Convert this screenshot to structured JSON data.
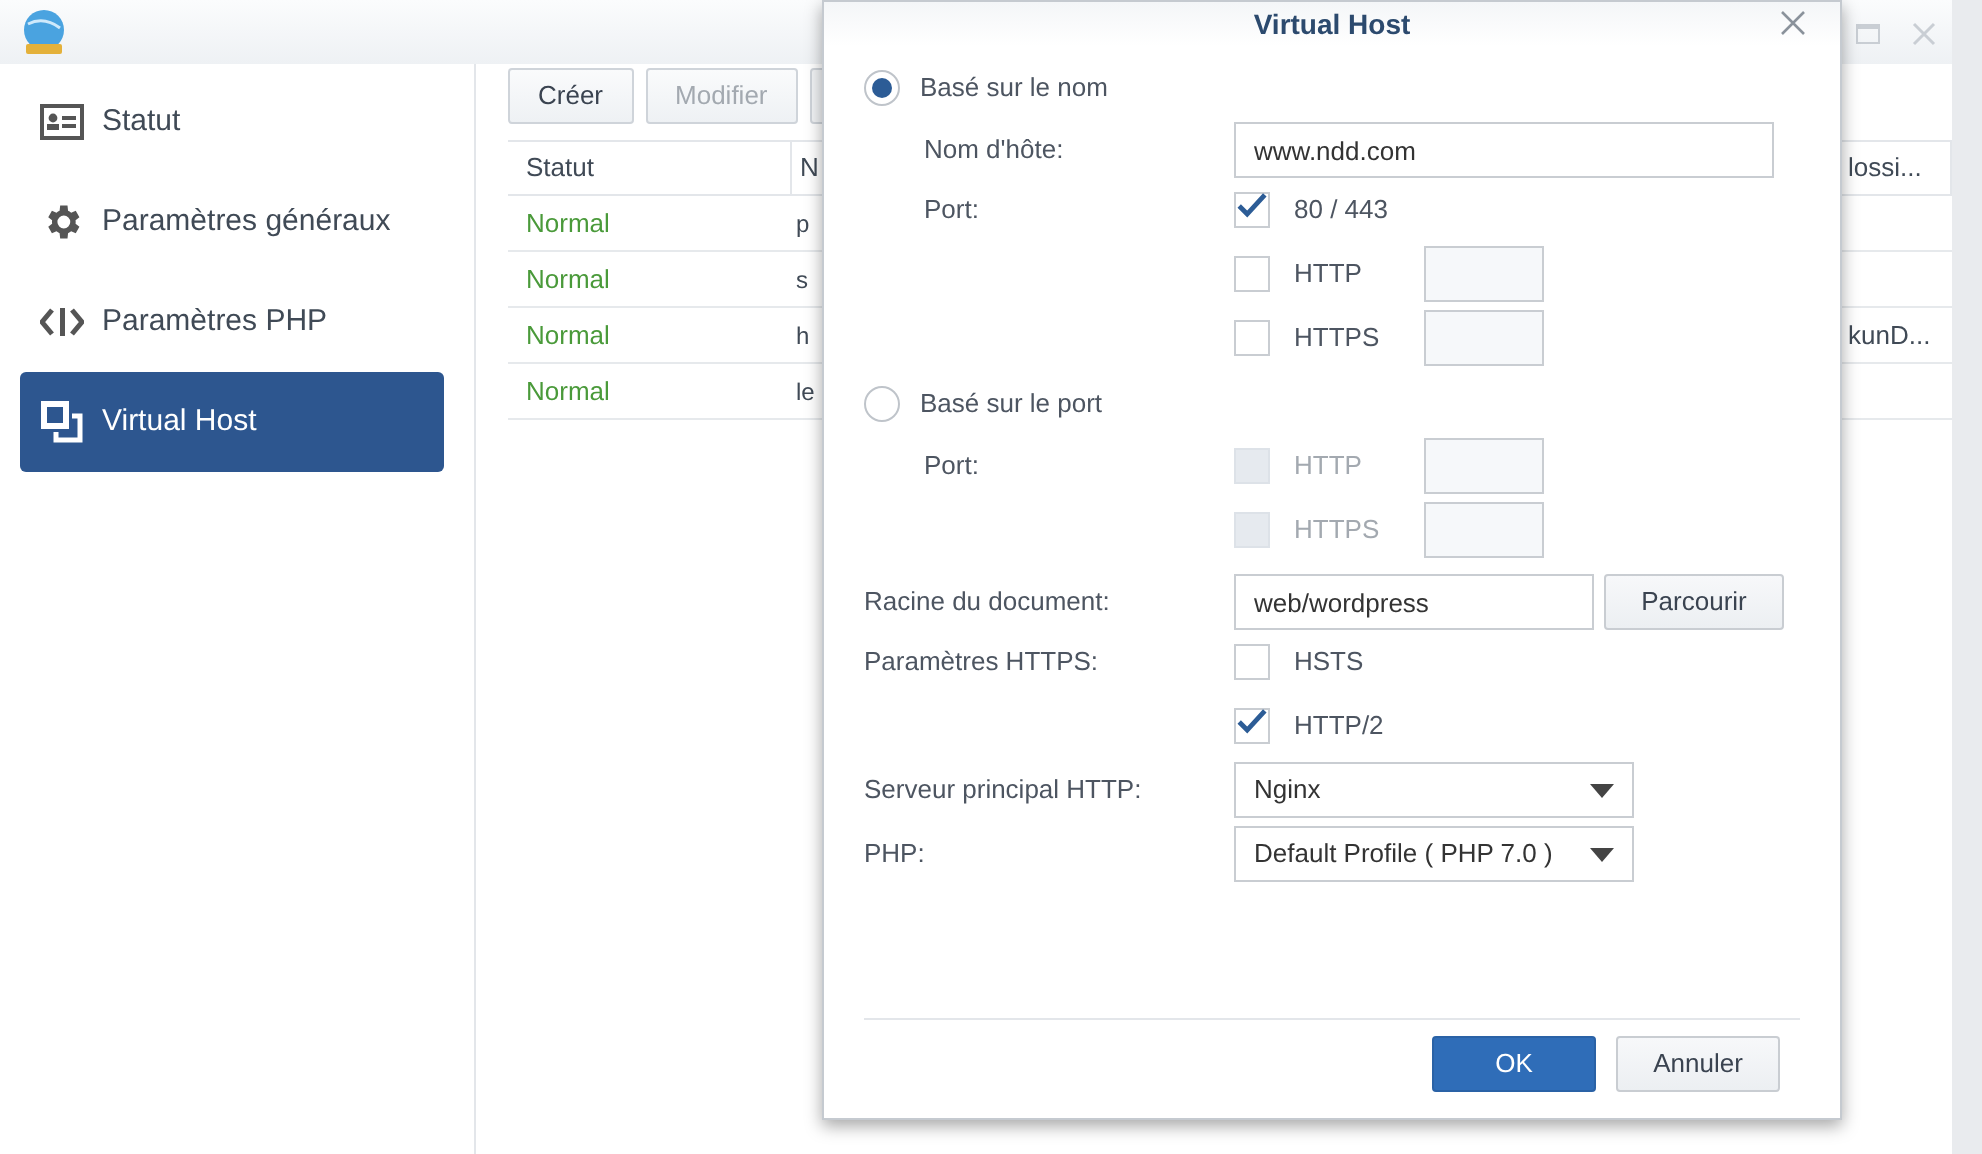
{
  "sidebar": {
    "items": [
      {
        "label": "Statut",
        "kind": "status",
        "selected": false
      },
      {
        "label": "Paramètres généraux",
        "kind": "general",
        "selected": false
      },
      {
        "label": "Paramètres PHP",
        "kind": "php",
        "selected": false
      },
      {
        "label": "Virtual Host",
        "kind": "vhost",
        "selected": true
      }
    ]
  },
  "toolbar": {
    "buttons": [
      {
        "label": "Créer",
        "disabled": false
      },
      {
        "label": "Modifier",
        "disabled": true
      }
    ]
  },
  "table": {
    "columns": [
      "Statut",
      "N"
    ],
    "column_3": "lossi...",
    "rows": [
      {
        "status": "Normal",
        "column_2": "p"
      },
      {
        "status": "Normal",
        "column_2": "s"
      },
      {
        "status": "Normal",
        "column_2": "h",
        "column_3": "kunD..."
      },
      {
        "status": "Normal",
        "column_2": "le"
      }
    ]
  },
  "dialog": {
    "title": "Virtual Host",
    "name_based": {
      "label": "Basé sur le nom",
      "selected": true,
      "hostname_label": "Nom d'hôte:",
      "hostname": "www.ndd.com",
      "port_label": "Port:",
      "ports": [
        {
          "label": "80 / 443",
          "checked": true,
          "kind": "preset"
        },
        {
          "label": "HTTP",
          "checked": false,
          "kind": "custom"
        },
        {
          "label": "HTTPS",
          "checked": false,
          "kind": "custom"
        }
      ]
    },
    "port_based": {
      "label": "Basé sur le port",
      "selected": false,
      "port_label": "Port:",
      "ports": [
        {
          "label": "HTTP",
          "checked": false,
          "disabled": true
        },
        {
          "label": "HTTPS",
          "checked": false,
          "disabled": true
        }
      ]
    },
    "document_root": {
      "label": "Racine du document:",
      "value": "web/wordpress",
      "button": "Parcourir"
    },
    "https_settings": {
      "label": "Paramètres HTTPS:",
      "options": [
        {
          "label": "HSTS",
          "checked": false
        },
        {
          "label": "HTTP/2",
          "checked": true
        }
      ]
    },
    "backend": {
      "label": "Serveur principal HTTP:",
      "value": "Nginx"
    },
    "php": {
      "label": "PHP:",
      "value": "Default Profile ( PHP 7.0 )"
    },
    "buttons": [
      {
        "label": "OK",
        "primary": true
      },
      {
        "label": "Annuler",
        "primary": false
      }
    ]
  }
}
